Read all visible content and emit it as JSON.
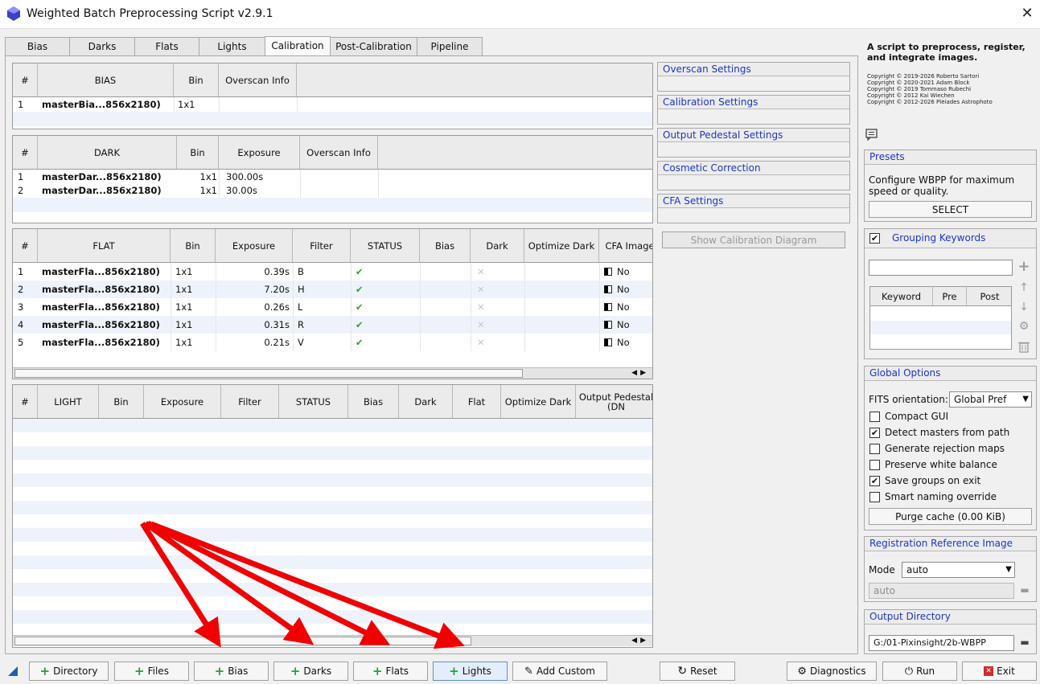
{
  "window": {
    "title": "Weighted Batch Preprocessing Script v2.9.1",
    "close": "✕"
  },
  "tabs": [
    "Bias",
    "Darks",
    "Flats",
    "Lights",
    "Calibration",
    "Post-Calibration",
    "Pipeline"
  ],
  "active_tab": "Calibration",
  "bias_table": {
    "headers": [
      "#",
      "BIAS",
      "Bin",
      "Overscan Info"
    ],
    "rows": [
      {
        "n": "1",
        "name": "masterBia...856x2180)",
        "bin": "1x1",
        "overscan": ""
      }
    ]
  },
  "dark_table": {
    "headers": [
      "#",
      "DARK",
      "Bin",
      "Exposure",
      "Overscan Info"
    ],
    "rows": [
      {
        "n": "1",
        "name": "masterDar...856x2180)",
        "bin": "1x1",
        "exposure": "300.00s",
        "overscan": ""
      },
      {
        "n": "2",
        "name": "masterDar...856x2180)",
        "bin": "1x1",
        "exposure": "30.00s",
        "overscan": ""
      }
    ]
  },
  "flat_table": {
    "headers": [
      "#",
      "FLAT",
      "Bin",
      "Exposure",
      "Filter",
      "STATUS",
      "Bias",
      "Dark",
      "Optimize Dark",
      "CFA Images"
    ],
    "rows": [
      {
        "n": "1",
        "name": "masterFla...856x2180)",
        "bin": "1x1",
        "exposure": "0.39s",
        "filter": "B",
        "status": "✔",
        "dark": "✕",
        "cfa": "No"
      },
      {
        "n": "2",
        "name": "masterFla...856x2180)",
        "bin": "1x1",
        "exposure": "7.20s",
        "filter": "H",
        "status": "✔",
        "dark": "✕",
        "cfa": "No"
      },
      {
        "n": "3",
        "name": "masterFla...856x2180)",
        "bin": "1x1",
        "exposure": "0.26s",
        "filter": "L",
        "status": "✔",
        "dark": "✕",
        "cfa": "No"
      },
      {
        "n": "4",
        "name": "masterFla...856x2180)",
        "bin": "1x1",
        "exposure": "0.31s",
        "filter": "R",
        "status": "✔",
        "dark": "✕",
        "cfa": "No"
      },
      {
        "n": "5",
        "name": "masterFla...856x2180)",
        "bin": "1x1",
        "exposure": "0.21s",
        "filter": "V",
        "status": "✔",
        "dark": "✕",
        "cfa": "No"
      }
    ]
  },
  "light_table": {
    "headers": [
      "#",
      "LIGHT",
      "Bin",
      "Exposure",
      "Filter",
      "STATUS",
      "Bias",
      "Dark",
      "Flat",
      "Optimize Dark",
      "Output Pedestal (DN"
    ],
    "rows": []
  },
  "settings_sections": [
    "Overscan Settings",
    "Calibration Settings",
    "Output Pedestal Settings",
    "Cosmetic Correction",
    "CFA Settings"
  ],
  "show_diagram_button": "Show Calibration Diagram",
  "info": {
    "description": "A script to preprocess, register, and integrate images.",
    "copyrights": [
      "Copyright © 2019-2026 Roberto Sartori",
      "Copyright © 2020-2021 Adam Block",
      "Copyright © 2019 Tommaso Rubechi",
      "Copyright © 2012 Kai Wiechen",
      "Copyright © 2012-2026 Pleiades Astrophoto"
    ]
  },
  "presets": {
    "title": "Presets",
    "text": "Configure WBPP for maximum speed or quality.",
    "button": "SELECT"
  },
  "grouping": {
    "title": "Grouping Keywords",
    "checked": true,
    "input_value": "",
    "headers": [
      "Keyword",
      "Pre",
      "Post"
    ]
  },
  "global_options": {
    "title": "Global Options",
    "fits_label": "FITS orientation:",
    "fits_value": "Global Pref",
    "options": [
      {
        "label": "Compact GUI",
        "checked": false
      },
      {
        "label": "Detect masters from path",
        "checked": true
      },
      {
        "label": "Generate rejection maps",
        "checked": false
      },
      {
        "label": "Preserve white balance",
        "checked": false
      },
      {
        "label": "Save groups on exit",
        "checked": true
      },
      {
        "label": "Smart naming override",
        "checked": false
      }
    ],
    "purge_button": "Purge cache (0.00 KiB)"
  },
  "registration": {
    "title": "Registration Reference Image",
    "mode_label": "Mode",
    "mode_value": "auto",
    "field_value": "auto"
  },
  "output_dir": {
    "title": "Output Directory",
    "value": "G:/01-Pixinsight/2b-WBPP"
  },
  "bottom_buttons": {
    "directory": "Directory",
    "files": "Files",
    "bias": "Bias",
    "darks": "Darks",
    "flats": "Flats",
    "lights": "Lights",
    "add_custom": "Add Custom",
    "reset": "Reset",
    "diagnostics": "Diagnostics",
    "run": "Run",
    "exit": "Exit"
  },
  "colors": {
    "accent_blue": "#1a36c8",
    "arrow_red": "#f00000",
    "plus_green": "#2e9b3a"
  }
}
